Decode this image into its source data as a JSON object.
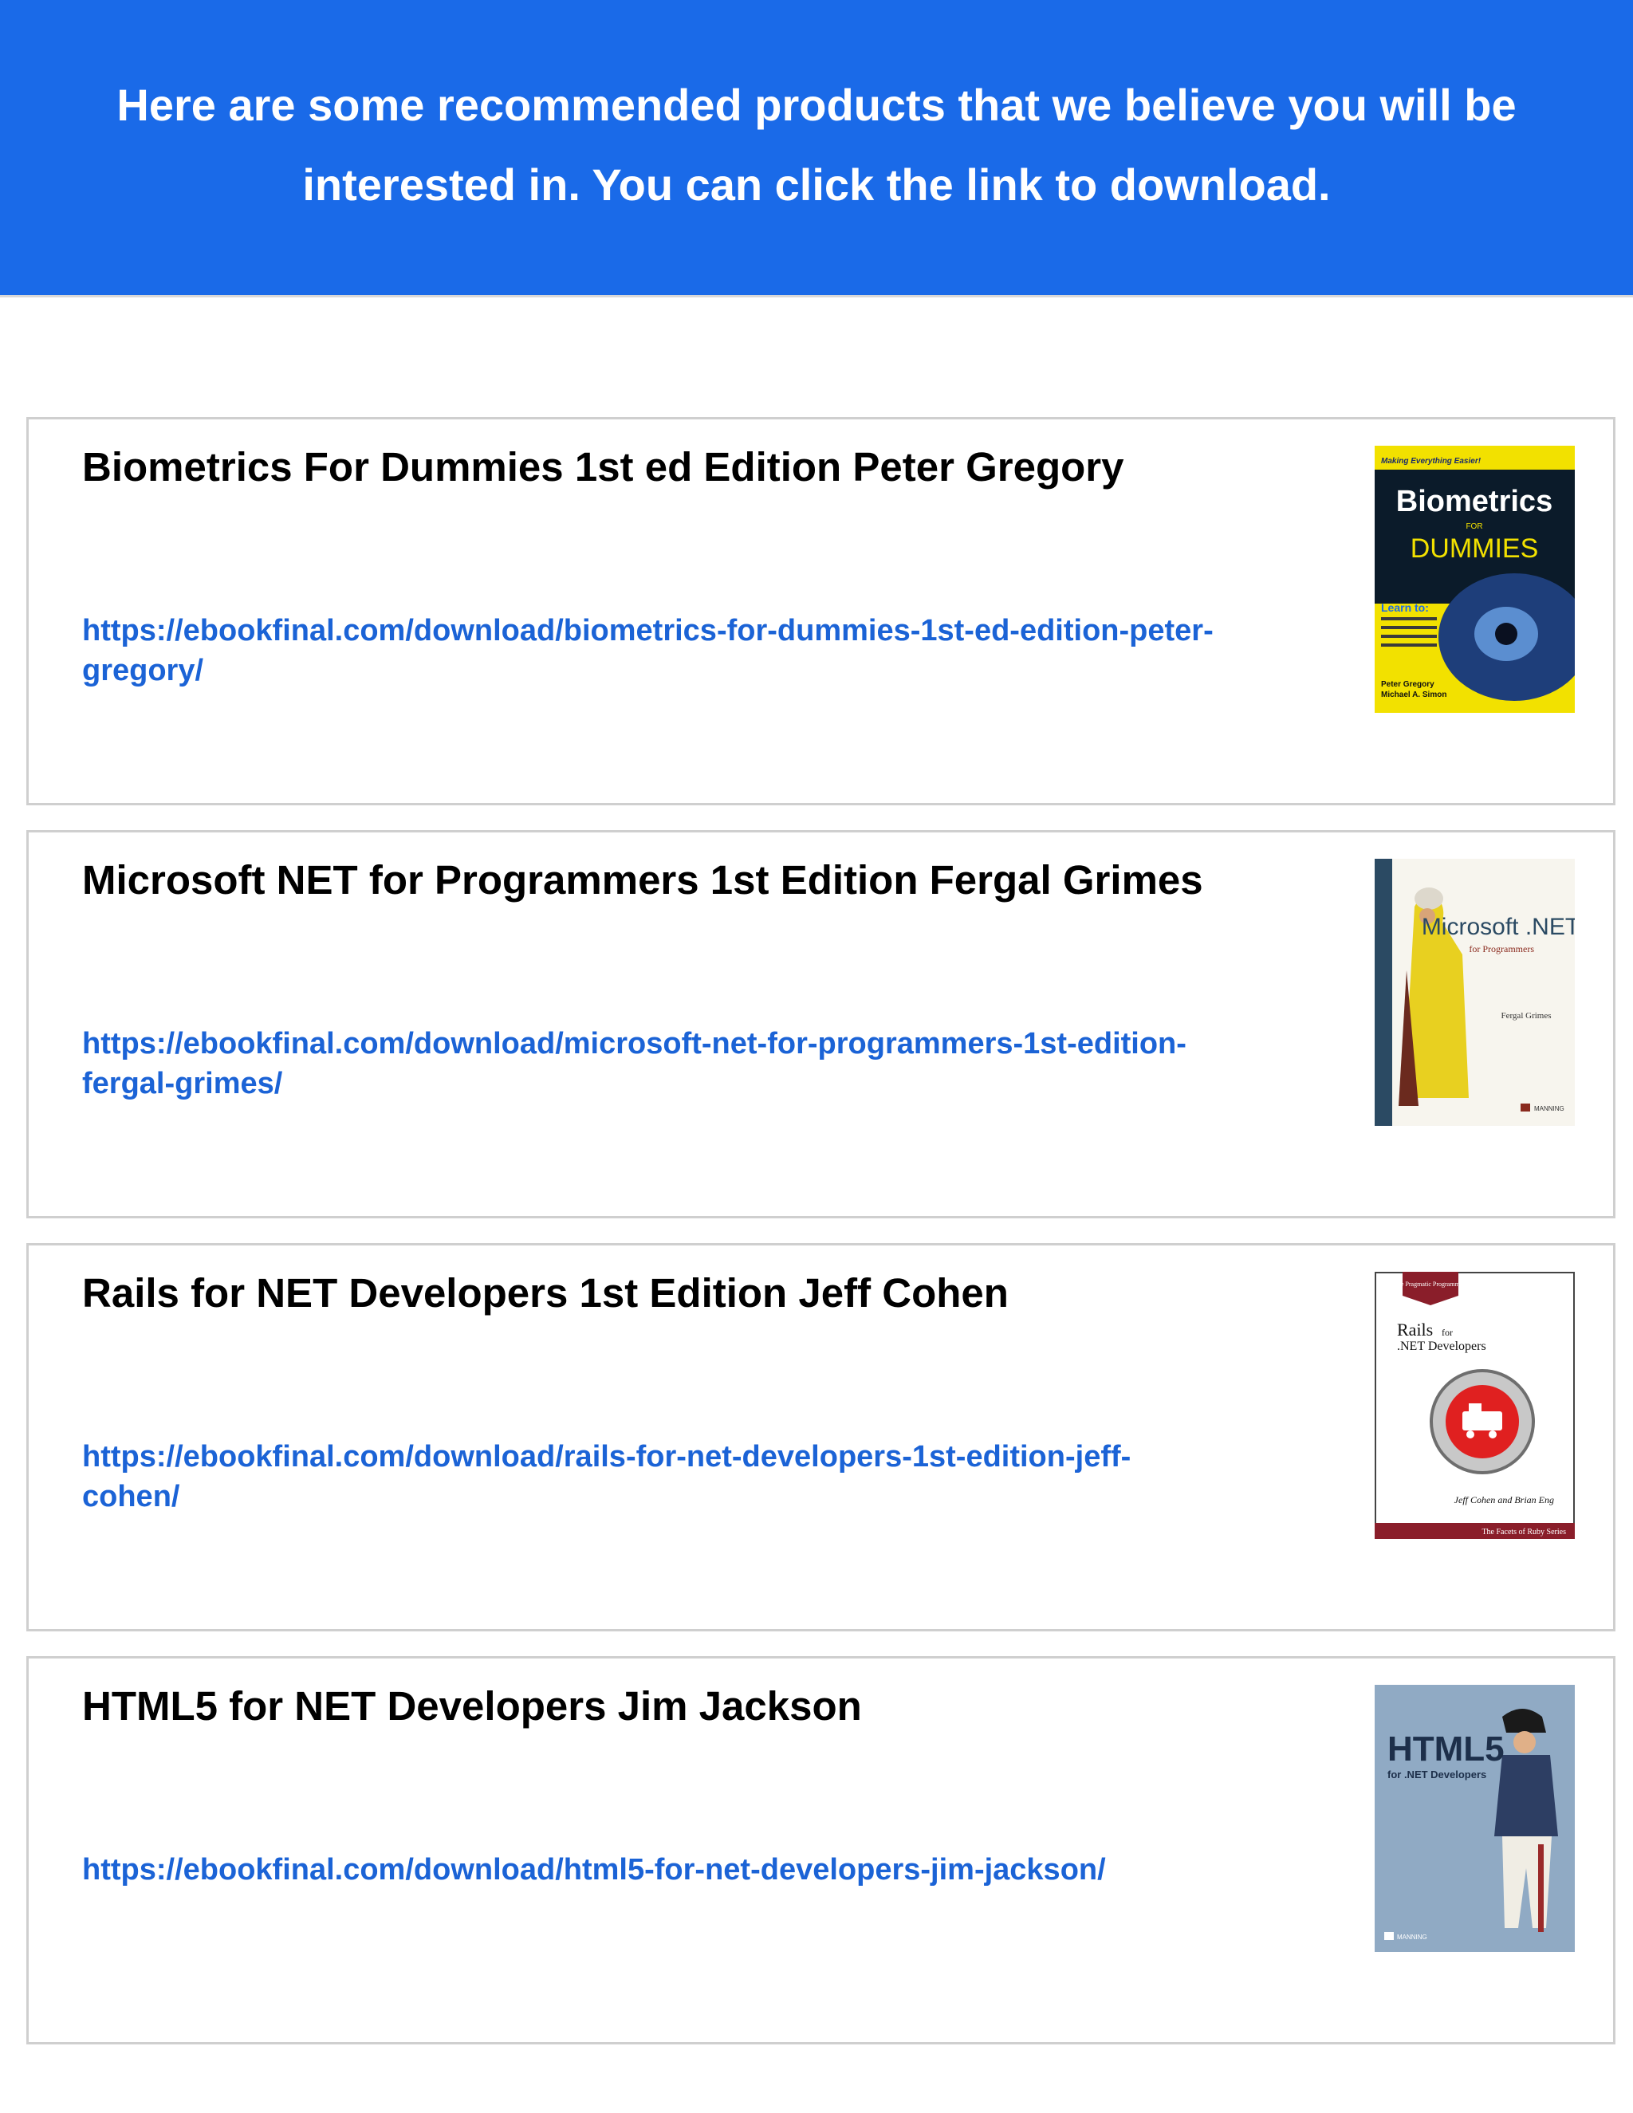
{
  "header": {
    "text": "Here are some recommended products that we believe you will be interested in. You can click the link to download."
  },
  "products": [
    {
      "title": "Biometrics For Dummies 1st ed Edition Peter Gregory",
      "link": "https://ebookfinal.com/download/biometrics-for-dummies-1st-ed-edition-peter-gregory/",
      "cover": {
        "tagline": "Making Everything Easier!",
        "title_main": "Biometrics",
        "title_for": "FOR",
        "title_series": "DUMMIES",
        "learn": "Learn to:",
        "authors": [
          "Peter Gregory",
          "Michael A. Simon"
        ],
        "bg": "#f2e100"
      }
    },
    {
      "title": "Microsoft NET for Programmers 1st Edition Fergal Grimes",
      "link": "https://ebookfinal.com/download/microsoft-net-for-programmers-1st-edition-fergal-grimes/",
      "cover": {
        "title_main": "Microsoft .NET",
        "subtitle": "for Programmers",
        "author": "Fergal Grimes",
        "publisher": "MANNING",
        "bg": "#f7f5ee"
      }
    },
    {
      "title": "Rails for NET Developers 1st Edition Jeff Cohen",
      "link": "https://ebookfinal.com/download/rails-for-net-developers-1st-edition-jeff-cohen/",
      "cover": {
        "badge": "The Pragmatic Programmers",
        "title_main": "Rails",
        "title_for": "for",
        "subtitle": ".NET Developers",
        "authors": "Jeff Cohen and Brian Eng",
        "series": "The Facets of Ruby Series",
        "bg": "#ffffff"
      }
    },
    {
      "title": "HTML5 for NET Developers Jim Jackson",
      "link": "https://ebookfinal.com/download/html5-for-net-developers-jim-jackson/",
      "cover": {
        "title_main": "HTML5",
        "subtitle": "for .NET Developers",
        "publisher": "MANNING",
        "bg": "#90aac4"
      }
    }
  ]
}
